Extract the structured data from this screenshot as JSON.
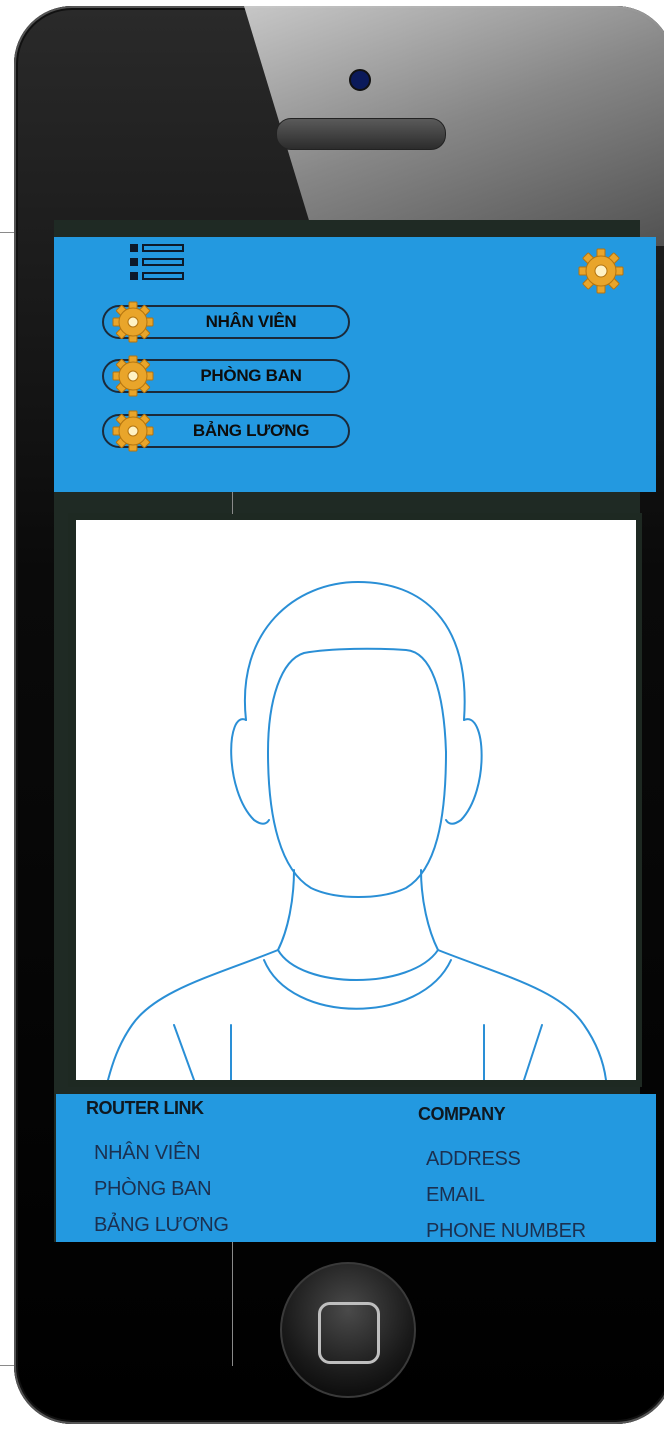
{
  "header": {
    "menu_icon": "list-menu-icon",
    "settings_icon": "gear-icon",
    "nav": [
      {
        "label": "NHÂN VIÊN",
        "icon": "gear-icon"
      },
      {
        "label": "PHÒNG BAN",
        "icon": "gear-icon"
      },
      {
        "label": "BẢNG LƯƠNG",
        "icon": "gear-icon"
      }
    ]
  },
  "photo": {
    "icon": "user-avatar-placeholder"
  },
  "footer": {
    "router_title": "ROUTER LINK",
    "router_links": [
      "NHÂN VIÊN",
      "PHÒNG BAN",
      "BẢNG LƯƠNG"
    ],
    "company_title": "COMPANY",
    "company_items": [
      "ADDRESS",
      "EMAIL",
      "PHONE NUMBER"
    ]
  },
  "colors": {
    "accent": "#2399e0",
    "phone_body": "#000000",
    "gear": "#f2b33d",
    "avatar_stroke": "#2a8fd6"
  }
}
